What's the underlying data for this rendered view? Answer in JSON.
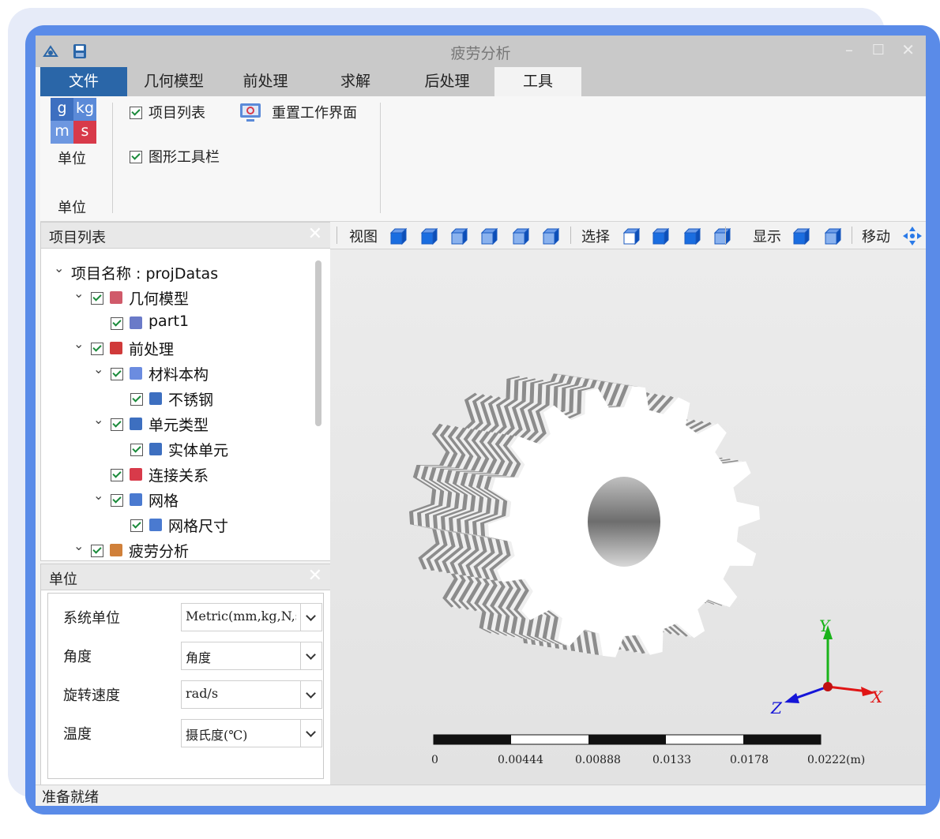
{
  "window": {
    "title": "疲劳分析"
  },
  "tabs": [
    "文件",
    "几何模型",
    "前处理",
    "求解",
    "后处理",
    "工具"
  ],
  "ribbon": {
    "unit_icon_letters": [
      "g",
      "kg",
      "m",
      "s"
    ],
    "unit_button_label": "单位",
    "group_label": "单位",
    "project_list_check": "项目列表",
    "graphics_toolbar_check": "图形工具栏",
    "reset_ui_label": "重置工作界面"
  },
  "project_panel": {
    "title": "项目列表",
    "tree": [
      {
        "label": "项目名称 : projDatas",
        "level": 0,
        "arrow": true,
        "check": false,
        "icon": ""
      },
      {
        "label": "几何模型",
        "level": 1,
        "arrow": true,
        "check": true,
        "icon": "geometry-icon"
      },
      {
        "label": "part1",
        "level": 2,
        "arrow": false,
        "check": true,
        "icon": "part-icon"
      },
      {
        "label": "前处理",
        "level": 1,
        "arrow": true,
        "check": true,
        "icon": "preprocess-icon"
      },
      {
        "label": "材料本构",
        "level": 2,
        "arrow": true,
        "check": true,
        "icon": "material-icon"
      },
      {
        "label": "不锈钢",
        "level": 3,
        "arrow": false,
        "check": true,
        "icon": "grid-material-icon"
      },
      {
        "label": "单元类型",
        "level": 2,
        "arrow": true,
        "check": true,
        "icon": "element-type-icon"
      },
      {
        "label": "实体单元",
        "level": 3,
        "arrow": false,
        "check": true,
        "icon": "solid-element-icon"
      },
      {
        "label": "连接关系",
        "level": 2,
        "arrow": false,
        "check": true,
        "icon": "connection-icon"
      },
      {
        "label": "网格",
        "level": 2,
        "arrow": true,
        "check": true,
        "icon": "mesh-icon"
      },
      {
        "label": "网格尺寸",
        "level": 3,
        "arrow": false,
        "check": true,
        "icon": "mesh-size-icon"
      },
      {
        "label": "疲劳分析",
        "level": 1,
        "arrow": true,
        "check": true,
        "icon": "fatigue-icon"
      }
    ]
  },
  "units_panel": {
    "title": "单位",
    "rows": [
      {
        "label": "系统单位",
        "value": "Metric(mm,kg,N,s"
      },
      {
        "label": "角度",
        "value": "角度"
      },
      {
        "label": "旋转速度",
        "value": "rad/s"
      },
      {
        "label": "温度",
        "value": "摄氏度(℃)"
      }
    ]
  },
  "view_toolbar": {
    "view_label": "视图",
    "select_label": "选择",
    "display_label": "显示",
    "move_label": "移动"
  },
  "viewport": {
    "axes": {
      "x": "X",
      "y": "Y",
      "z": "Z"
    },
    "scale_bar_ticks": [
      "0",
      "0.00444",
      "0.00888",
      "0.0133",
      "0.0178",
      "0.0222(m)"
    ]
  },
  "status": {
    "text": "准备就绪"
  },
  "colors": {
    "frame": "#5a8be8",
    "file_tab": "#2a66a8",
    "titlebar": "#c9c9c9",
    "axis_x": "#e01515",
    "axis_y": "#19b319",
    "axis_z": "#1515d8"
  }
}
